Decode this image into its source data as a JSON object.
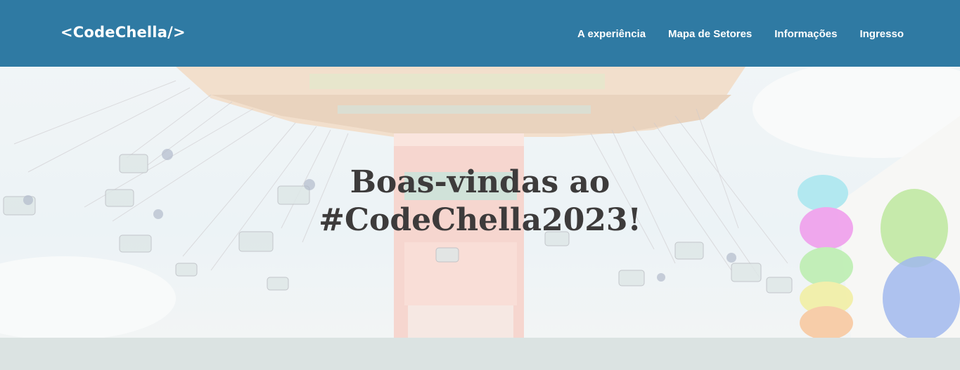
{
  "header": {
    "logo": "<CodeChella/>",
    "nav": [
      {
        "label": "A experiência"
      },
      {
        "label": "Mapa de Setores"
      },
      {
        "label": "Informações"
      },
      {
        "label": "Ingresso"
      }
    ]
  },
  "hero": {
    "title_line1": "Boas-vindas ao",
    "title_line2": "#CodeChella2023!"
  },
  "colors": {
    "header_bg": "#2f7aa3",
    "title_text": "#3d3b3b",
    "band_bg": "#dbe3e2"
  }
}
